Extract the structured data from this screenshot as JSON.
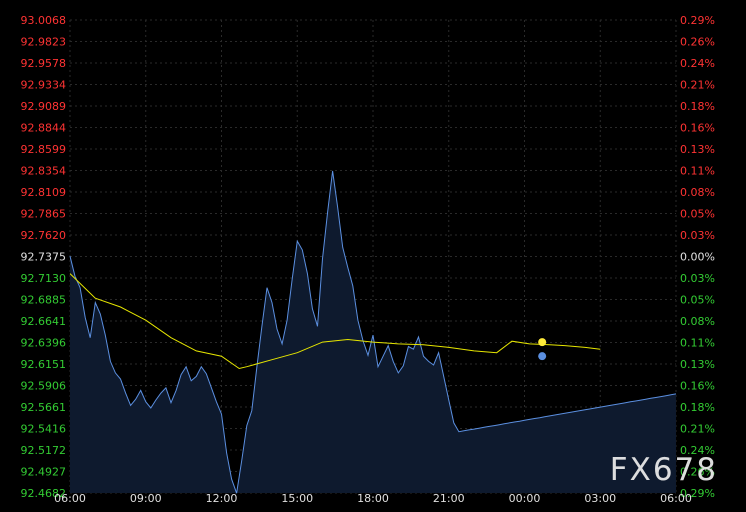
{
  "watermark": "FX678",
  "colors": {
    "background": "#000000",
    "grid": "#2a2a2a",
    "price_line": "#5b8fe0",
    "area_fill": "#0e1a2e",
    "average_line": "#e6e600",
    "up_label": "#ff3333",
    "down_label": "#33cc33",
    "neutral_label": "#e0e0e0",
    "x_label": "#e0e0e0"
  },
  "chart_data": {
    "type": "line",
    "title": "",
    "xlabel": "",
    "ylabel": "",
    "reference_price": 92.7375,
    "ylim": [
      92.4682,
      93.0068
    ],
    "grid": true,
    "x_ticks": [
      "06:00",
      "09:00",
      "12:00",
      "15:00",
      "18:00",
      "21:00",
      "00:00",
      "03:00",
      "06:00"
    ],
    "y_ticks_left": [
      "93.0068",
      "92.9823",
      "92.9578",
      "92.9334",
      "92.9089",
      "92.8844",
      "92.8599",
      "92.8354",
      "92.8109",
      "92.7865",
      "92.7620",
      "92.7375",
      "92.7130",
      "92.6885",
      "92.6641",
      "92.6396",
      "92.6151",
      "92.5906",
      "92.5661",
      "92.5416",
      "92.5172",
      "92.4927",
      "92.4682"
    ],
    "y_ticks_right": [
      "0.29%",
      "0.26%",
      "0.24%",
      "0.21%",
      "0.18%",
      "0.16%",
      "0.13%",
      "0.11%",
      "0.08%",
      "0.05%",
      "0.03%",
      "0.00%",
      "0.03%",
      "0.05%",
      "0.08%",
      "0.11%",
      "0.13%",
      "0.16%",
      "0.18%",
      "0.21%",
      "0.24%",
      "0.26%",
      "0.29%"
    ],
    "x_hours": [
      0,
      24
    ],
    "series": [
      {
        "kind": "price",
        "x": [
          0.0,
          0.2,
          0.4,
          0.6,
          0.8,
          1.0,
          1.2,
          1.4,
          1.6,
          1.8,
          2.0,
          2.2,
          2.4,
          2.6,
          2.8,
          3.0,
          3.2,
          3.4,
          3.6,
          3.8,
          4.0,
          4.2,
          4.4,
          4.6,
          4.8,
          5.0,
          5.2,
          5.4,
          5.6,
          5.8,
          6.0,
          6.2,
          6.4,
          6.6,
          6.8,
          7.0,
          7.2,
          7.4,
          7.6,
          7.8,
          8.0,
          8.2,
          8.4,
          8.6,
          8.8,
          9.0,
          9.2,
          9.4,
          9.6,
          9.8,
          10.0,
          10.2,
          10.4,
          10.6,
          10.8,
          11.0,
          11.2,
          11.4,
          11.6,
          11.8,
          12.0,
          12.2,
          12.4,
          12.6,
          12.8,
          13.0,
          13.2,
          13.4,
          13.6,
          13.8,
          14.0,
          14.2,
          14.4,
          14.6,
          14.8,
          15.0,
          15.2,
          15.4,
          15.6,
          15.8,
          16.0,
          16.2,
          16.4,
          16.6,
          16.8,
          17.0,
          17.2,
          17.4,
          17.6,
          17.8,
          18.0,
          18.2,
          18.4,
          18.6,
          18.8,
          19.0,
          19.2,
          19.4,
          19.6,
          19.8,
          20.0,
          20.2,
          20.4,
          20.6,
          20.8,
          21.0,
          21.2,
          21.4,
          21.6,
          21.8,
          22.0,
          22.2,
          22.4,
          22.6,
          22.8,
          23.0,
          23.2,
          23.4,
          23.6,
          23.8,
          24.0
        ],
        "values": [
          92.738,
          92.715,
          92.702,
          92.668,
          92.645,
          92.685,
          92.672,
          92.648,
          92.618,
          92.605,
          92.598,
          92.582,
          92.568,
          92.575,
          92.585,
          92.572,
          92.565,
          92.574,
          92.582,
          92.588,
          92.571,
          92.585,
          92.603,
          92.612,
          92.596,
          92.601,
          92.612,
          92.604,
          92.588,
          92.572,
          92.558,
          92.514,
          92.484,
          92.468,
          92.505,
          92.545,
          92.562,
          92.612,
          92.658,
          92.702,
          92.685,
          92.655,
          92.638,
          92.665,
          92.712,
          92.755,
          92.745,
          92.718,
          92.678,
          92.658,
          92.735,
          92.788,
          92.835,
          92.794,
          92.748,
          92.725,
          92.704,
          92.665,
          92.642,
          92.625,
          92.648,
          92.612,
          92.624,
          92.636,
          92.618,
          92.605,
          92.613,
          92.635,
          92.632,
          92.646,
          92.624,
          92.618,
          92.614,
          92.628,
          92.601,
          92.574,
          92.548,
          92.538,
          92.539,
          92.54,
          92.541,
          92.542,
          92.543,
          92.544,
          92.545,
          92.546,
          92.547,
          92.548,
          92.549,
          92.55,
          92.551,
          92.552,
          92.553,
          92.554,
          92.555,
          92.556,
          92.557,
          92.558,
          92.559,
          92.56,
          92.561,
          92.562,
          92.563,
          92.564,
          92.565,
          92.566,
          92.567,
          92.568,
          92.569,
          92.57,
          92.571,
          92.572,
          92.573,
          92.574,
          92.575,
          92.576,
          92.577,
          92.578,
          92.579,
          92.58,
          92.581
        ]
      },
      {
        "kind": "average",
        "x": [
          0.0,
          1.0,
          2.0,
          3.0,
          4.0,
          5.0,
          6.0,
          6.7,
          7.0,
          8.0,
          9.0,
          10.0,
          11.0,
          12.0,
          13.0,
          14.0,
          15.0,
          16.0,
          16.9,
          17.5,
          18.2,
          19.0,
          19.6,
          20.4,
          21.0
        ],
        "values": [
          92.718,
          92.69,
          92.68,
          92.665,
          92.645,
          92.63,
          92.624,
          92.61,
          92.612,
          92.62,
          92.628,
          92.64,
          92.643,
          92.64,
          92.638,
          92.637,
          92.634,
          92.63,
          92.628,
          92.641,
          92.638,
          92.637,
          92.636,
          92.634,
          92.632
        ]
      }
    ],
    "markers": [
      {
        "x": 18.7,
        "value": 92.64,
        "color": "#ffeb3b"
      },
      {
        "x": 18.7,
        "value": 92.624,
        "color": "#5b8fe0"
      }
    ]
  }
}
